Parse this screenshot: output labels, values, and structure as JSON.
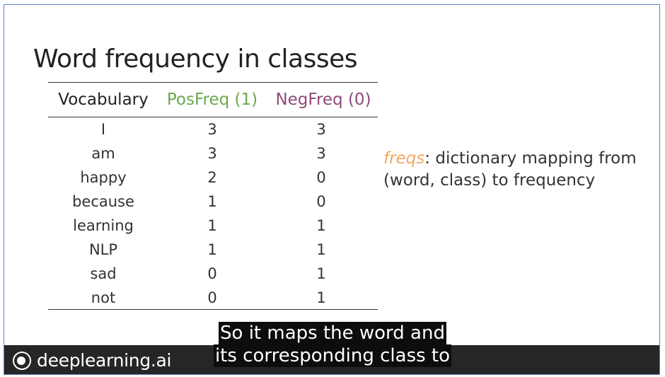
{
  "slide": {
    "title": "Word frequency in classes",
    "table": {
      "headers": {
        "vocab": "Vocabulary",
        "pos": "PosFreq (1)",
        "neg": "NegFreq (0)"
      },
      "rows": [
        {
          "word": "I",
          "pos": "3",
          "neg": "3"
        },
        {
          "word": "am",
          "pos": "3",
          "neg": "3"
        },
        {
          "word": "happy",
          "pos": "2",
          "neg": "0"
        },
        {
          "word": "because",
          "pos": "1",
          "neg": "0"
        },
        {
          "word": "learning",
          "pos": "1",
          "neg": "1"
        },
        {
          "word": "NLP",
          "pos": "1",
          "neg": "1"
        },
        {
          "word": "sad",
          "pos": "0",
          "neg": "1"
        },
        {
          "word": "not",
          "pos": "0",
          "neg": "1"
        }
      ]
    },
    "note": {
      "key": "freqs",
      "rest": ": dictionary mapping from (word, class) to frequency"
    }
  },
  "footer": {
    "logo_text": "deeplearning.ai"
  },
  "caption": {
    "line1": "So it maps the word and",
    "line2": "its corresponding class to"
  },
  "colors": {
    "pos_header": "#6aa84f",
    "neg_header": "#8e4a78",
    "note_key": "#f0a860",
    "frame_border": "#5b86c8",
    "footer_bg": "#262626"
  }
}
